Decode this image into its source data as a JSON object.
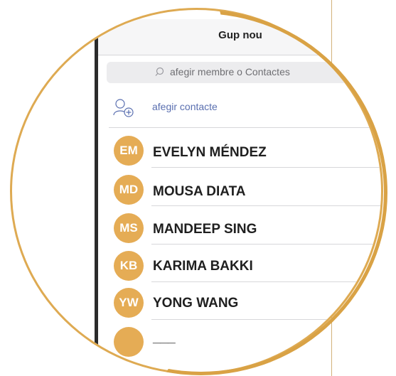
{
  "header": {
    "title": "Gup nou"
  },
  "search": {
    "placeholder": "afegir membre o Contactes"
  },
  "add_contact": {
    "label": "afegir contacte"
  },
  "contacts": [
    {
      "initials": "EM",
      "name": "EVELYN MÉNDEZ"
    },
    {
      "initials": "MD",
      "name": "MOUSA DIATA"
    },
    {
      "initials": "MS",
      "name": "MANDEEP SING"
    },
    {
      "initials": "KB",
      "name": "KARIMA BAKKI"
    },
    {
      "initials": "YW",
      "name": "YONG WANG"
    },
    {
      "initials": "",
      "name": "___"
    }
  ],
  "colors": {
    "accent": "#e5ac55",
    "frame": "#deaa52",
    "link": "#5a6fb0"
  },
  "icons": {
    "search": "search-icon",
    "add_contact": "add-person-icon"
  }
}
